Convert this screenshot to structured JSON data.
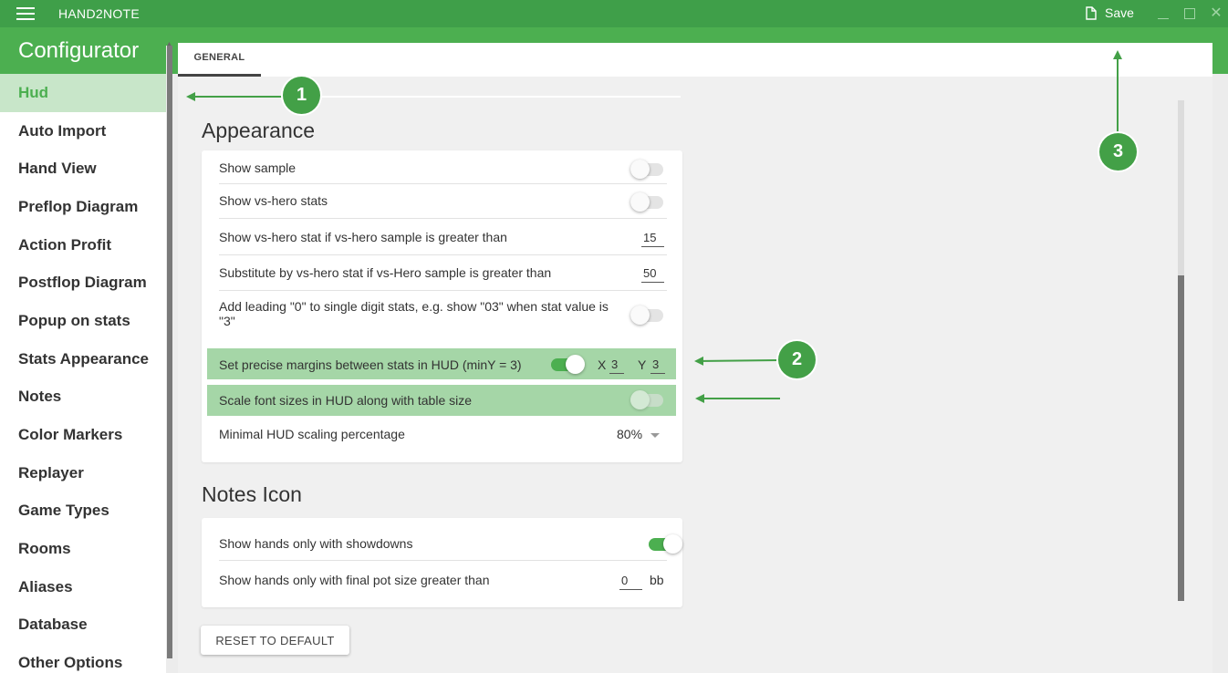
{
  "titlebar": {
    "app_name": "HAND2NOTE",
    "save_label": "Save"
  },
  "sidebar": {
    "title": "Configurator",
    "items": [
      {
        "label": "Hud",
        "active": true
      },
      {
        "label": "Auto Import"
      },
      {
        "label": "Hand View"
      },
      {
        "label": "Preflop Diagram"
      },
      {
        "label": "Action Profit"
      },
      {
        "label": "Postflop Diagram"
      },
      {
        "label": "Popup on stats"
      },
      {
        "label": "Stats Appearance"
      },
      {
        "label": "Notes"
      },
      {
        "label": "Color Markers"
      },
      {
        "label": "Replayer"
      },
      {
        "label": "Game Types"
      },
      {
        "label": "Rooms"
      },
      {
        "label": "Aliases"
      },
      {
        "label": "Database"
      },
      {
        "label": "Other Options"
      }
    ]
  },
  "tabs": [
    {
      "label": "GENERAL"
    }
  ],
  "appearance": {
    "title": "Appearance",
    "show_sample": {
      "label": "Show sample",
      "on": false
    },
    "show_vs_hero": {
      "label": "Show vs-hero stats",
      "on": false
    },
    "vs_hero_threshold": {
      "label": "Show vs-hero stat if vs-hero sample is greater than",
      "value": "15"
    },
    "substitute_threshold": {
      "label": "Substitute by vs-hero stat if vs-Hero sample is greater than",
      "value": "50"
    },
    "leading_zero": {
      "label": "Add leading \"0\" to single digit stats, e.g. show \"03\" when stat value is \"3\"",
      "on": false
    },
    "precise_margins": {
      "label": "Set precise margins between stats in HUD (minY = 3)",
      "on": true,
      "x_label": "X",
      "x_value": "3",
      "y_label": "Y",
      "y_value": "3"
    },
    "scale_font": {
      "label": "Scale font sizes in HUD along with table size",
      "on": false
    },
    "min_scaling": {
      "label": "Minimal HUD scaling percentage",
      "value": "80%"
    }
  },
  "notes_icon": {
    "title": "Notes Icon",
    "showdowns": {
      "label": "Show hands only with showdowns",
      "on": true
    },
    "final_pot": {
      "label": "Show hands only with final pot size greater than",
      "value": "0",
      "unit": "bb"
    }
  },
  "reset_label": "RESET TO DEFAULT",
  "annotations": [
    "1",
    "2",
    "3"
  ],
  "colors": {
    "accent": "#4caf50",
    "titlebar": "#3f9f49",
    "highlight": "#a5d6a7",
    "active_nav": "#c8e6c9"
  }
}
